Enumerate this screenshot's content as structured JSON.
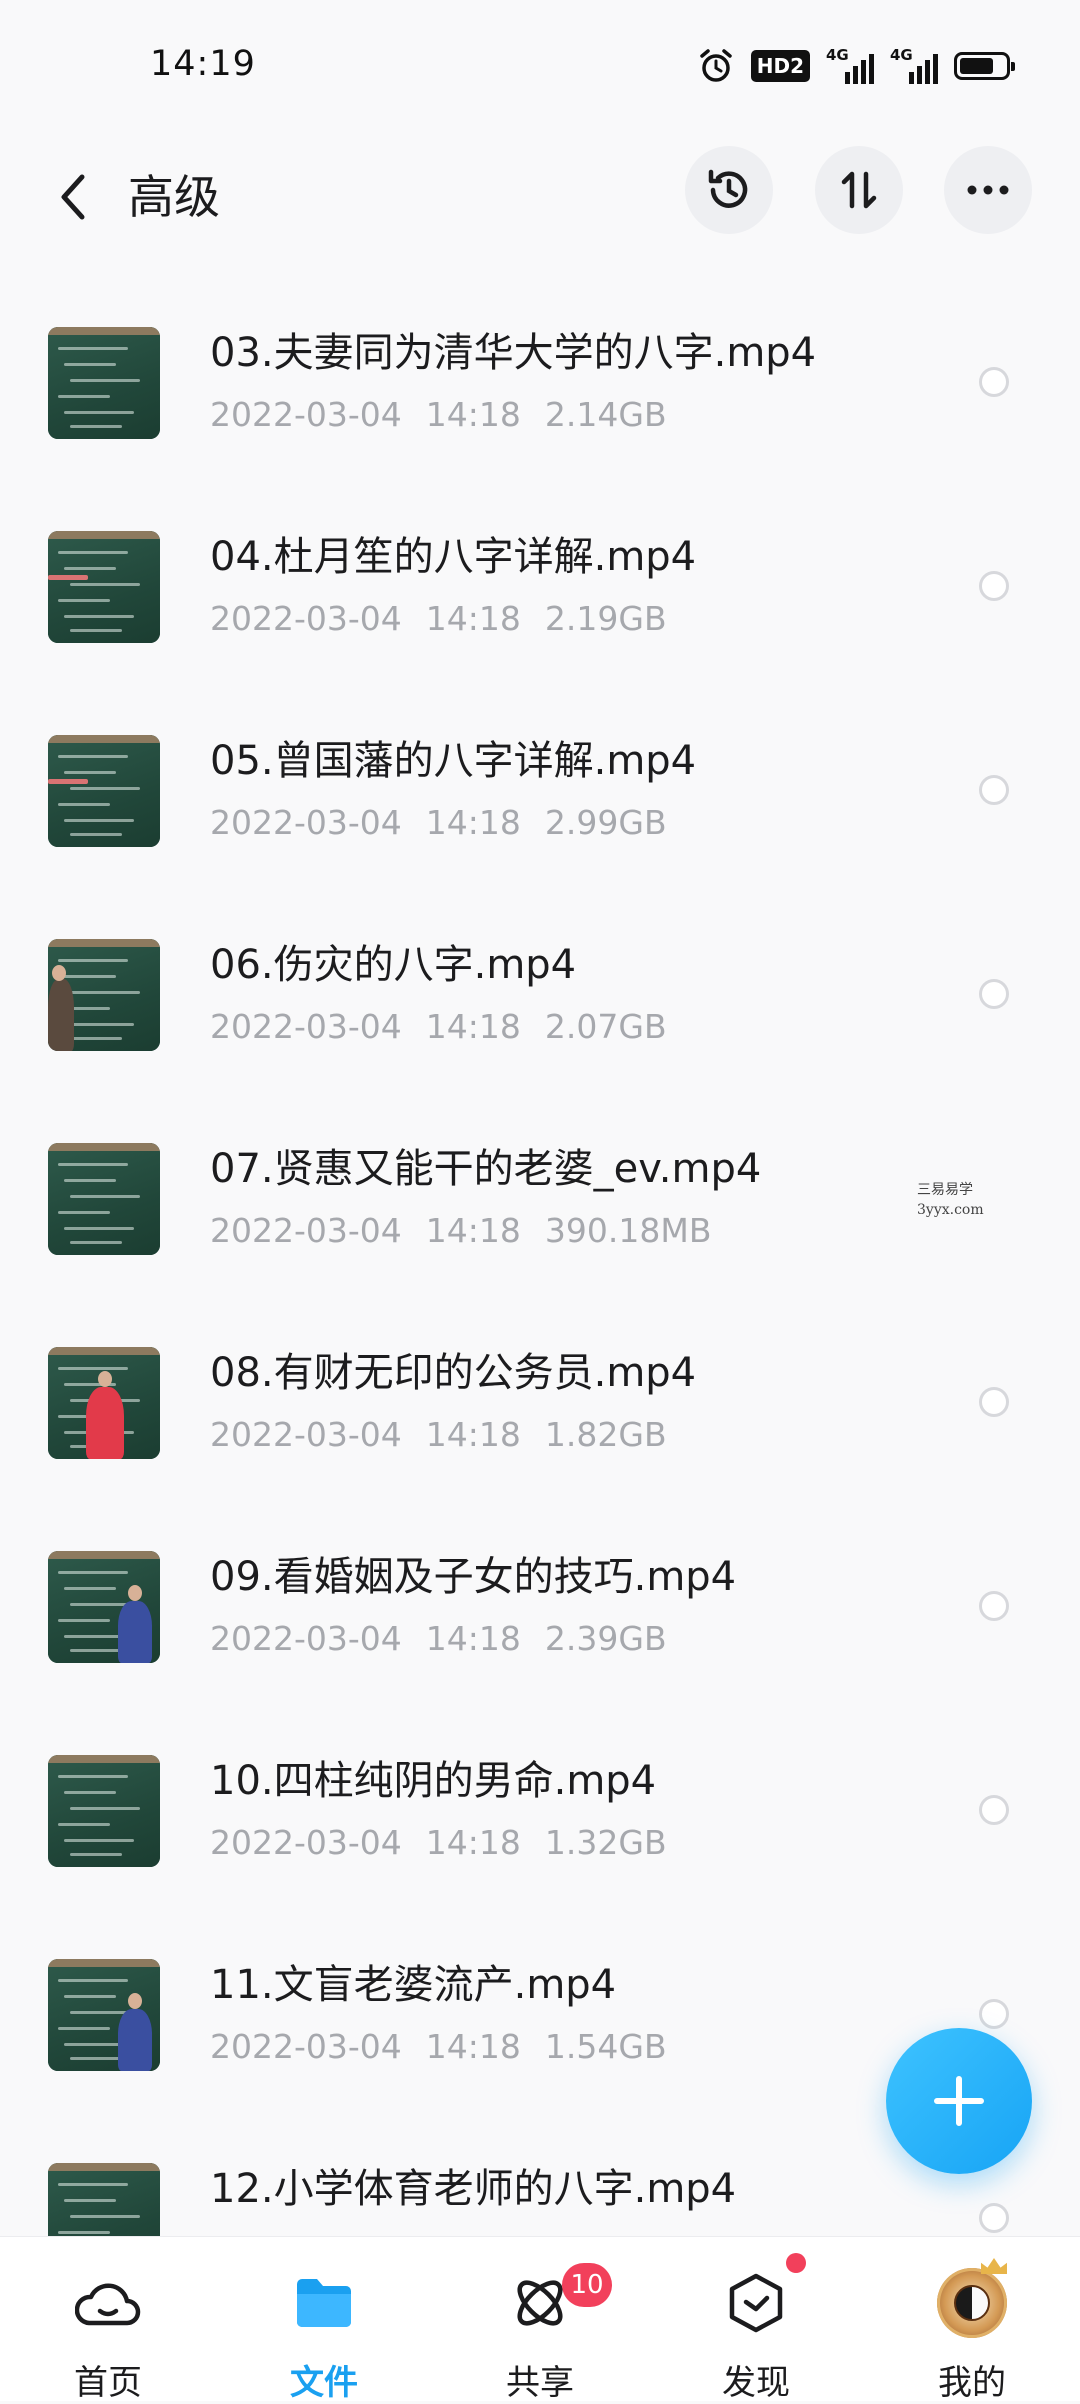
{
  "status_bar": {
    "time": "14:19",
    "hd_label": "HD2",
    "signal1_label": "4G",
    "signal2_label": "4G",
    "battery_level": 0.75,
    "icons": [
      "alarm-icon",
      "hd-voice-icon",
      "signal-4g-icon",
      "signal-4g-icon",
      "battery-icon"
    ]
  },
  "header": {
    "title": "高级",
    "buttons": [
      "back-icon",
      "history-icon",
      "sort-icon",
      "more-icon"
    ]
  },
  "files": [
    {
      "name": "03.夫妻同为清华大学的八字.mp4",
      "date": "2022-03-04",
      "time": "14:18",
      "size": "2.14GB",
      "thumb": "board"
    },
    {
      "name": "04.杜月笙的八字详解.mp4",
      "date": "2022-03-04",
      "time": "14:18",
      "size": "2.19GB",
      "thumb": "pointer-left"
    },
    {
      "name": "05.曾国藩的八字详解.mp4",
      "date": "2022-03-04",
      "time": "14:18",
      "size": "2.99GB",
      "thumb": "pointer-left"
    },
    {
      "name": "06.伤灾的八字.mp4",
      "date": "2022-03-04",
      "time": "14:18",
      "size": "2.07GB",
      "thumb": "person-left"
    },
    {
      "name": "07.贤惠又能干的老婆_ev.mp4",
      "date": "2022-03-04",
      "time": "14:18",
      "size": "390.18MB",
      "thumb": "board"
    },
    {
      "name": "08.有财无印的公务员.mp4",
      "date": "2022-03-04",
      "time": "14:18",
      "size": "1.82GB",
      "thumb": "person-red"
    },
    {
      "name": "09.看婚姻及子女的技巧.mp4",
      "date": "2022-03-04",
      "time": "14:18",
      "size": "2.39GB",
      "thumb": "person-right"
    },
    {
      "name": "10.四柱纯阴的男命.mp4",
      "date": "2022-03-04",
      "time": "14:18",
      "size": "1.32GB",
      "thumb": "board"
    },
    {
      "name": "11.文盲老婆流产.mp4",
      "date": "2022-03-04",
      "time": "14:18",
      "size": "1.54GB",
      "thumb": "person-right"
    },
    {
      "name": "12.小学体育老师的八字.mp4",
      "date": "",
      "time": "",
      "size": "",
      "thumb": "board"
    }
  ],
  "watermark": {
    "line1": "三易易学",
    "line2": "3yyx.com"
  },
  "fab": {
    "icon": "plus-icon"
  },
  "bottom_nav": [
    {
      "label": "首页",
      "icon": "home-cloud-icon",
      "active": false
    },
    {
      "label": "文件",
      "icon": "folder-icon",
      "active": true
    },
    {
      "label": "共享",
      "icon": "share-atom-icon",
      "active": false,
      "badge": "10"
    },
    {
      "label": "发现",
      "icon": "discover-box-icon",
      "active": false,
      "dot": true
    },
    {
      "label": "我的",
      "icon": "avatar",
      "active": false
    }
  ],
  "colors": {
    "accent": "#1aa0f0",
    "badge": "#f2405b",
    "meta_text": "#a6a8ad"
  }
}
